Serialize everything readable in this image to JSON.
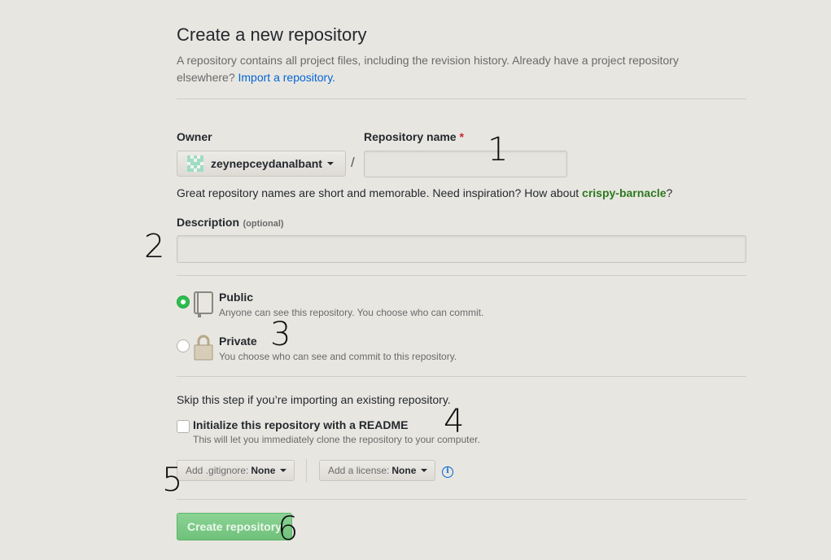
{
  "page": {
    "title": "Create a new repository",
    "description": "A repository contains all project files, including the revision history. Already have a project repository elsewhere?",
    "import_link": "Import a repository."
  },
  "owner": {
    "label": "Owner",
    "value": "zeynepceydanalbant"
  },
  "repo_name": {
    "label": "Repository name",
    "required_mark": "*",
    "value": "",
    "placeholder": ""
  },
  "slash": "/",
  "hint": {
    "text": "Great repository names are short and memorable. Need inspiration? How about",
    "suggestion": "crispy-barnacle",
    "end": "?"
  },
  "description": {
    "label": "Description",
    "optional": "(optional)",
    "value": ""
  },
  "visibility": {
    "public": {
      "title": "Public",
      "desc": "Anyone can see this repository. You choose who can commit.",
      "selected": true,
      "icon": "repo-icon"
    },
    "private": {
      "title": "Private",
      "desc": "You choose who can see and commit to this repository.",
      "selected": false,
      "icon": "lock-icon"
    }
  },
  "init": {
    "skip_text": "Skip this step if you’re importing an existing repository.",
    "readme_title": "Initialize this repository with a README",
    "readme_desc": "This will let you immediately clone the repository to your computer.",
    "checked": false
  },
  "gitignore": {
    "label": "Add .gitignore:",
    "value": "None"
  },
  "license": {
    "label": "Add a license:",
    "value": "None"
  },
  "create_button": "Create repository",
  "markers": [
    "1",
    "2",
    "3",
    "4",
    "5",
    "6"
  ],
  "colors": {
    "accent_green": "#2cbe4e",
    "link_blue": "#0366d6",
    "background": "#e8e6e1"
  }
}
